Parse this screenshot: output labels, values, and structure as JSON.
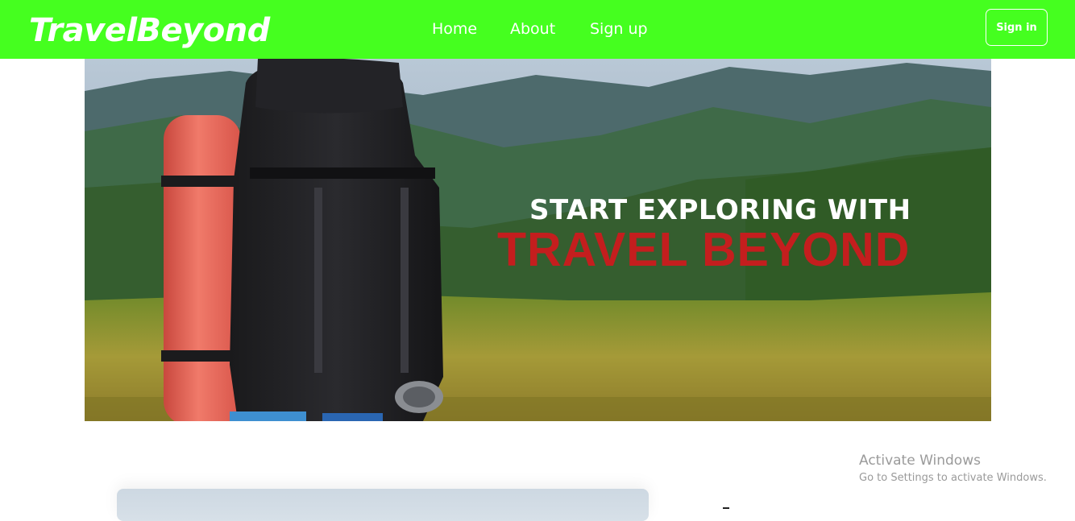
{
  "navbar": {
    "brand": "TravelBeyond",
    "links": [
      "Home",
      "About",
      "Sign up"
    ],
    "signin_label": "Sign in",
    "bg_color": "#45ff1f"
  },
  "hero": {
    "line1": "START EXPLORING WITH",
    "line2": "TRAVEL BEYOND",
    "line2_color": "#c41e1e"
  },
  "watermark": {
    "title": "Activate Windows",
    "subtitle": "Go to Settings to activate Windows."
  }
}
